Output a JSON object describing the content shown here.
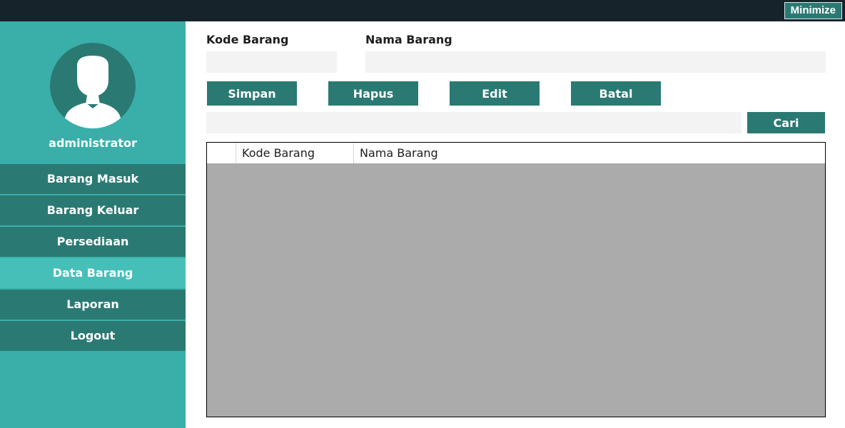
{
  "window": {
    "minimize_label": "Minimize"
  },
  "sidebar": {
    "username": "administrator",
    "items": [
      {
        "label": "Barang Masuk",
        "active": false
      },
      {
        "label": "Barang Keluar",
        "active": false
      },
      {
        "label": "Persediaan",
        "active": false
      },
      {
        "label": "Data Barang",
        "active": true
      },
      {
        "label": "Laporan",
        "active": false
      },
      {
        "label": "Logout",
        "active": false
      }
    ]
  },
  "form": {
    "kode_label": "Kode Barang",
    "kode_value": "",
    "nama_label": "Nama Barang",
    "nama_value": "",
    "buttons": {
      "simpan": "Simpan",
      "hapus": "Hapus",
      "edit": "Edit",
      "batal": "Batal"
    },
    "search_value": "",
    "cari_label": "Cari"
  },
  "table": {
    "columns": [
      "Kode Barang",
      "Nama Barang"
    ],
    "rows": []
  },
  "colors": {
    "topbar": "#17232b",
    "sidebar": "#3aafa9",
    "accent": "#2a7a73",
    "active_item": "#47bfb9",
    "grid_background": "#ababab"
  }
}
